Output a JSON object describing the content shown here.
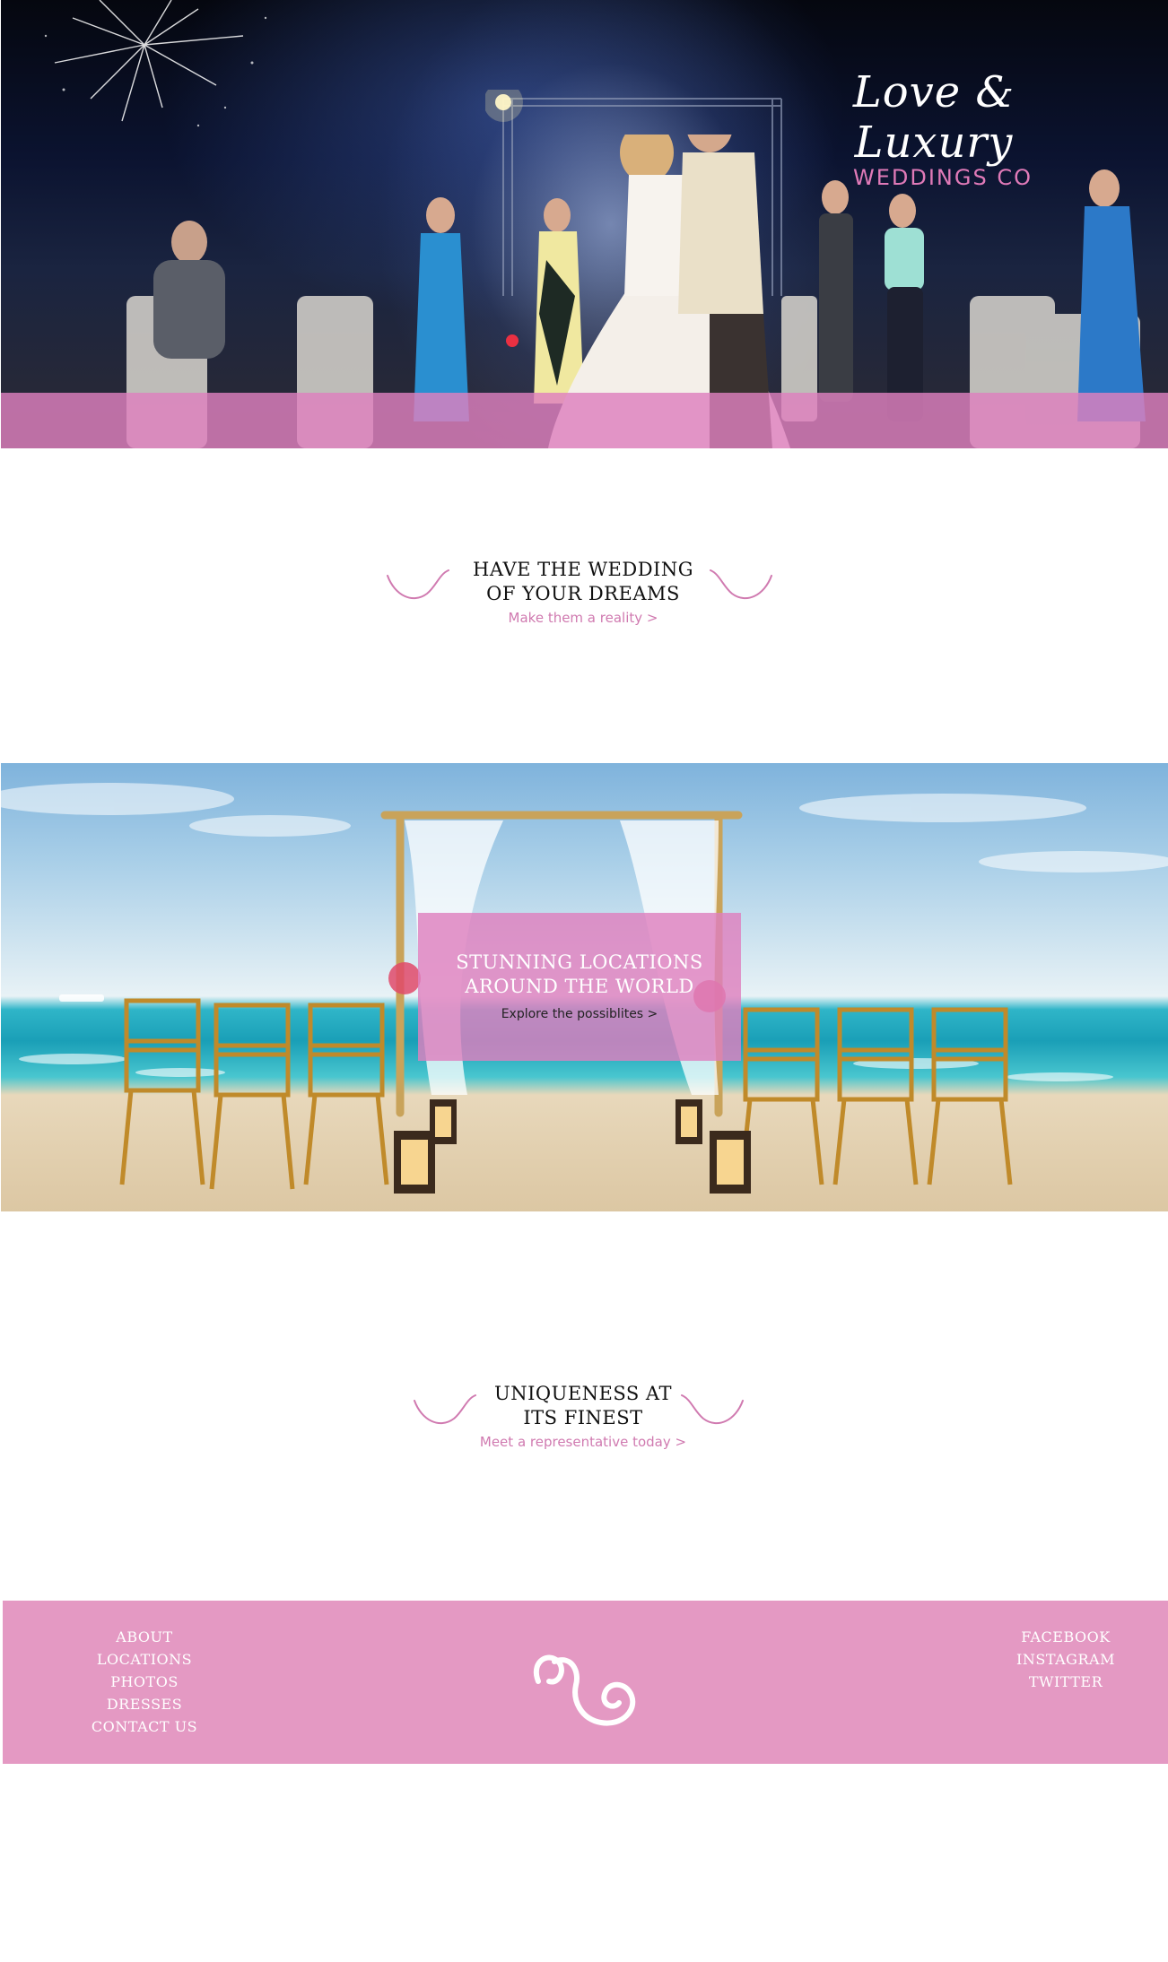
{
  "hero": {
    "brand_script": "Love & Luxury",
    "brand_sub": "WEDDINGS CO"
  },
  "section_dreams": {
    "title_line1": "HAVE THE WEDDING",
    "title_line2": "OF YOUR DREAMS",
    "link": "Make them a reality >"
  },
  "section_locations": {
    "title_line1": "STUNNING LOCATIONS",
    "title_line2": "AROUND THE WORLD",
    "link": "Explore the possiblites >"
  },
  "section_unique": {
    "title_line1": "UNIQUENESS AT",
    "title_line2": "ITS FINEST",
    "link": "Meet a representative today >"
  },
  "footer": {
    "nav": [
      "ABOUT",
      "LOCATIONS",
      "PHOTOS",
      "DRESSES",
      "CONTACT US"
    ],
    "social": [
      "FACEBOOK",
      "INSTAGRAM",
      "TWITTER"
    ],
    "logo_icon": "swirl-logo-icon"
  },
  "colors": {
    "accent_pink": "#e499c3",
    "link_pink": "#d07ab0",
    "band_pink": "#de80be"
  },
  "icons": [
    "swirl-left-icon",
    "swirl-right-icon",
    "swirl-logo-icon"
  ]
}
